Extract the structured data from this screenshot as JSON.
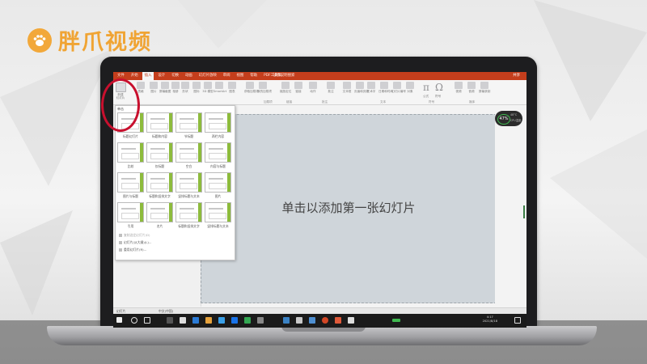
{
  "brand": {
    "logo_text": "胖爪视频",
    "color": "#f0a434"
  },
  "app": {
    "accent_color": "#c43e1c",
    "tabs": [
      "文件",
      "开始",
      "插入",
      "设计",
      "切换",
      "动画",
      "幻灯片放映",
      "审阅",
      "视图",
      "帮助",
      "PDF工具集"
    ],
    "active_tab_index": 2,
    "tell_me": "操作说明搜索",
    "share": "共享"
  },
  "ribbon": {
    "new_slide_label": "新建\n幻灯片",
    "items": [
      {
        "label": "表格",
        "icon": "table-icon"
      },
      {
        "label": "图片",
        "icon": "image-icon"
      },
      {
        "label": "屏幕截图",
        "icon": "screenshot-icon"
      },
      {
        "label": "相册",
        "icon": "album-icon"
      },
      {
        "label": "形状",
        "icon": "shapes-icon"
      },
      {
        "label": "图标",
        "icon": "icons-icon"
      },
      {
        "label": "3D 模型",
        "icon": "3d-icon"
      },
      {
        "label": "SmartArt",
        "icon": "smartart-icon"
      },
      {
        "label": "图表",
        "icon": "chart-icon"
      },
      {
        "label": "获取加载项",
        "icon": "addin-icon"
      },
      {
        "label": "我的加载项",
        "icon": "myaddin-icon"
      },
      {
        "label": "缩放定位",
        "icon": "zoom-icon"
      },
      {
        "label": "链接",
        "icon": "link-icon"
      },
      {
        "label": "动作",
        "icon": "action-icon"
      },
      {
        "label": "批注",
        "icon": "comment-icon"
      },
      {
        "label": "文本框",
        "icon": "textbox-icon"
      },
      {
        "label": "页眉和页脚",
        "icon": "header-icon"
      },
      {
        "label": "艺术字",
        "icon": "wordart-icon"
      },
      {
        "label": "日期和时间",
        "icon": "date-icon"
      },
      {
        "label": "幻灯片编号",
        "icon": "number-icon"
      },
      {
        "label": "对象",
        "icon": "object-icon"
      },
      {
        "label": "公式",
        "icon": "equation-icon"
      },
      {
        "label": "符号",
        "icon": "symbol-icon"
      },
      {
        "label": "视频",
        "icon": "video-icon"
      },
      {
        "label": "音频",
        "icon": "audio-icon"
      },
      {
        "label": "屏幕录制",
        "icon": "record-icon"
      }
    ],
    "group_labels": [
      "加载项",
      "链接",
      "批注",
      "文本",
      "符号",
      "媒体"
    ]
  },
  "dropdown": {
    "header": "单击",
    "layouts": [
      "标题幻灯片",
      "标题和内容",
      "节标题",
      "两栏内容",
      "比较",
      "仅标题",
      "空白",
      "内容与标题",
      "图片与标题",
      "标题和竖排文字",
      "竖排标题与文本",
      "图片",
      "引用",
      "名片",
      "标题和竖排文字",
      "竖排标题与文本"
    ],
    "actions": [
      {
        "label": "复制选定幻灯片(D)",
        "disabled": true
      },
      {
        "label": "幻灯片(从大纲)(L)...",
        "disabled": false
      },
      {
        "label": "重用幻灯片(R)...",
        "disabled": false
      }
    ]
  },
  "canvas": {
    "placeholder": "单击以添加第一张幻灯片"
  },
  "cpu_widget": {
    "percent": "47%",
    "temp": "48°C",
    "label": "CPU温度"
  },
  "statusbar": {
    "slide": "幻灯片",
    "language": "中文(中国)"
  },
  "taskbar": {
    "time": "4:17",
    "date": "2021/8/18"
  }
}
